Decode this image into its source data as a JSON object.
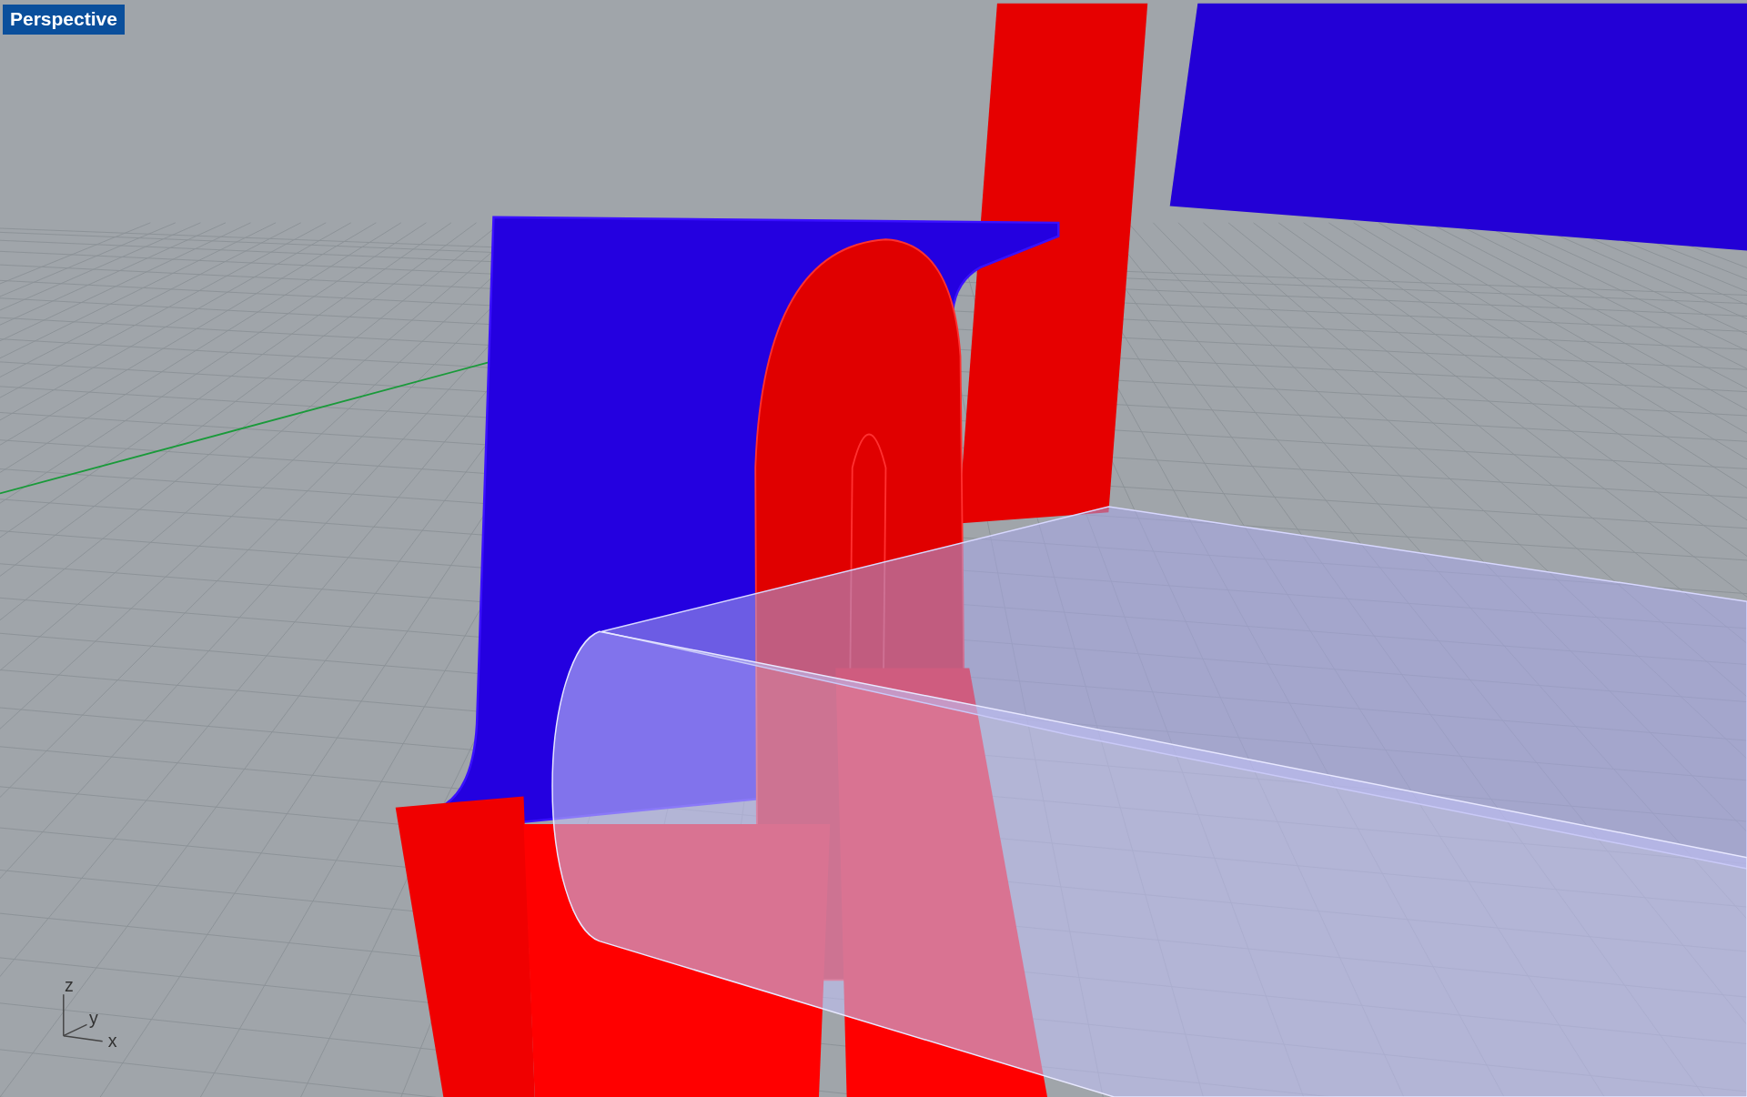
{
  "viewport": {
    "label": "Perspective"
  },
  "axis_labels": [
    "z",
    "y",
    "x"
  ]
}
